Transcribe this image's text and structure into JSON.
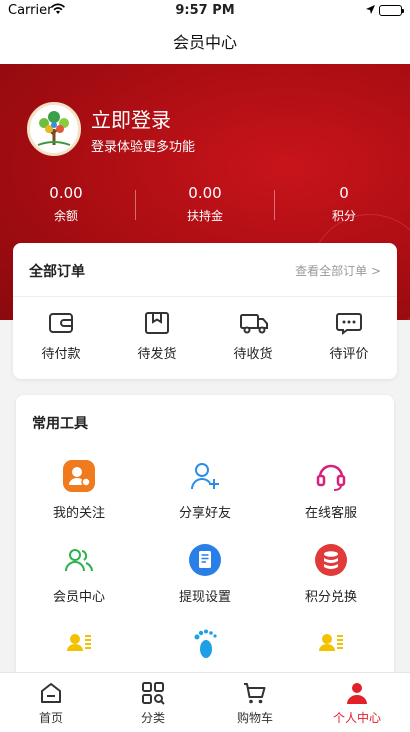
{
  "status_bar": {
    "carrier": "Carrier",
    "time": "9:57 PM"
  },
  "nav": {
    "title": "会员中心"
  },
  "profile": {
    "login_title": "立即登录",
    "login_subtitle": "登录体验更多功能"
  },
  "stats": [
    {
      "value": "0.00",
      "label": "余额"
    },
    {
      "value": "0.00",
      "label": "扶持金"
    },
    {
      "value": "0",
      "label": "积分"
    }
  ],
  "orders": {
    "title": "全部订单",
    "view_all": "查看全部订单 >",
    "items": [
      {
        "label": "待付款",
        "icon": "wallet-icon"
      },
      {
        "label": "待发货",
        "icon": "package-icon"
      },
      {
        "label": "待收货",
        "icon": "truck-icon"
      },
      {
        "label": "待评价",
        "icon": "comment-icon"
      }
    ]
  },
  "tools": {
    "title": "常用工具",
    "items": [
      {
        "label": "我的关注",
        "icon": "follow-icon",
        "color": "#f07a1e"
      },
      {
        "label": "分享好友",
        "icon": "add-friend-icon",
        "color": "#2a8ee8"
      },
      {
        "label": "在线客服",
        "icon": "headset-icon",
        "color": "#d8207a"
      },
      {
        "label": "会员中心",
        "icon": "members-icon",
        "color": "#2bb24c"
      },
      {
        "label": "提现设置",
        "icon": "document-icon",
        "color": "#2a7ee8"
      },
      {
        "label": "积分兑换",
        "icon": "database-icon",
        "color": "#e03a3a"
      },
      {
        "label": "",
        "icon": "contact-card-icon",
        "color": "#f2c200"
      },
      {
        "label": "",
        "icon": "footprint-icon",
        "color": "#1ea0e6"
      },
      {
        "label": "",
        "icon": "contact-card-icon",
        "color": "#f2c200"
      }
    ]
  },
  "tabs": [
    {
      "label": "首页",
      "icon": "home-icon"
    },
    {
      "label": "分类",
      "icon": "category-icon"
    },
    {
      "label": "购物车",
      "icon": "cart-icon"
    },
    {
      "label": "个人中心",
      "icon": "person-icon",
      "active": true
    }
  ],
  "colors": {
    "brand_red": "#c8141b",
    "active_tab": "#e1202a"
  }
}
